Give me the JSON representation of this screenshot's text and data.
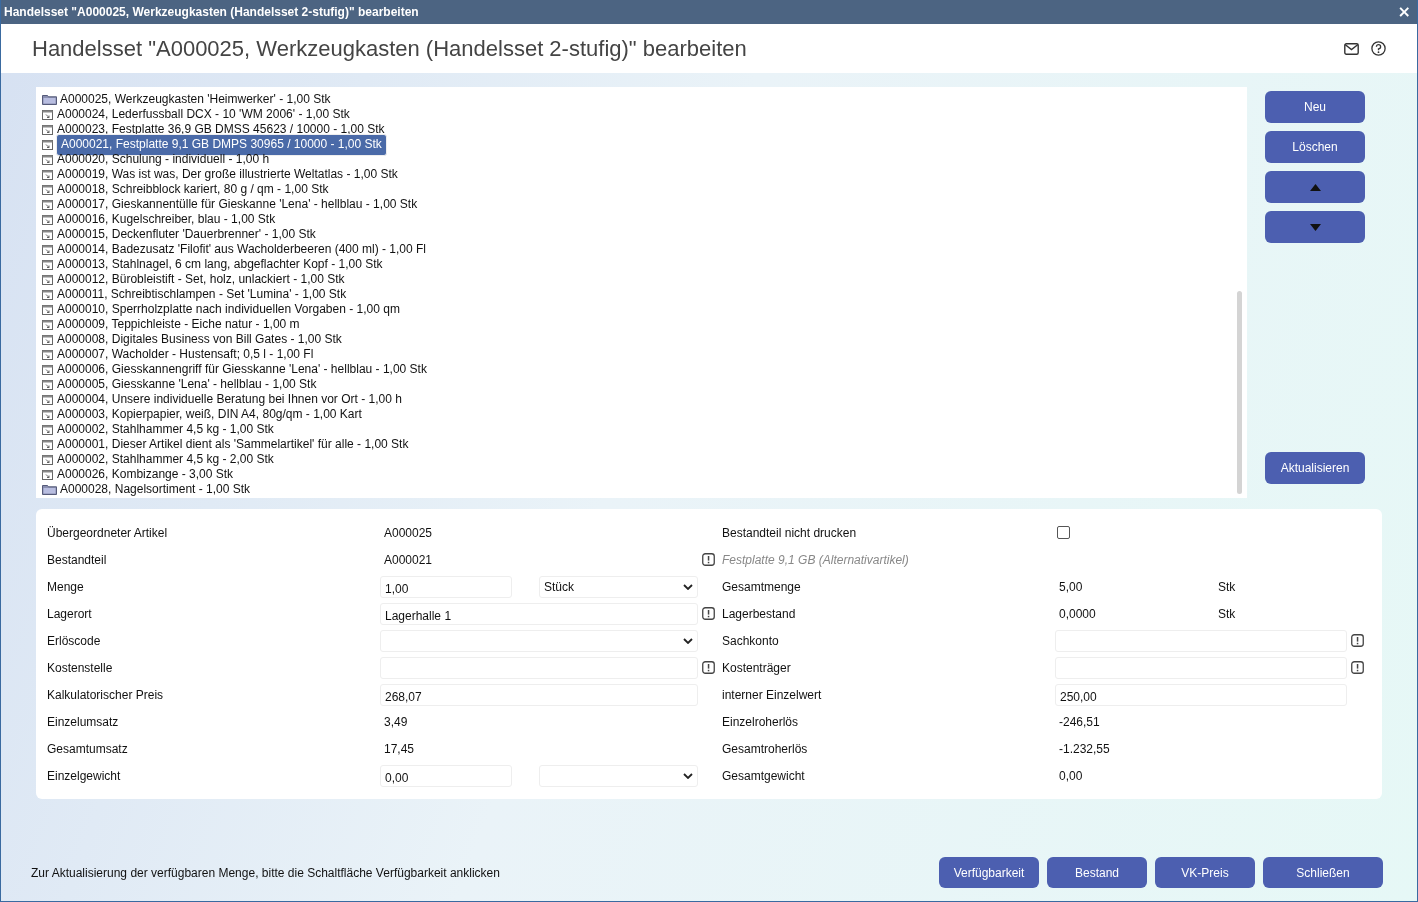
{
  "window": {
    "title": "Handelsset \"A000025, Werkzeugkasten (Handelsset 2-stufig)\" bearbeiten",
    "close": "×"
  },
  "header": {
    "title": "Handelsset \"A000025, Werkzeugkasten (Handelsset 2-stufig)\" bearbeiten"
  },
  "tree": {
    "items": [
      {
        "kind": "folder",
        "label": "A000025, Werkzeugkasten 'Heimwerker' - 1,00 Stk",
        "selected": false
      },
      {
        "kind": "article",
        "label": "A000024, Lederfussball DCX - 10 'WM 2006' - 1,00 Stk",
        "selected": false
      },
      {
        "kind": "article",
        "label": "A000023, Festplatte 36,9 GB DMSS 45623 / 10000 - 1,00 Stk",
        "selected": false
      },
      {
        "kind": "article",
        "label": "A000021, Festplatte 9,1 GB DMPS 30965 / 10000 - 1,00 Stk",
        "selected": true
      },
      {
        "kind": "article",
        "label": "A000020, Schulung - individuell - 1,00 h",
        "selected": false
      },
      {
        "kind": "article",
        "label": "A000019, Was ist was, Der große illustrierte Weltatlas - 1,00 Stk",
        "selected": false
      },
      {
        "kind": "article",
        "label": "A000018, Schreibblock kariert, 80 g / qm - 1,00 Stk",
        "selected": false
      },
      {
        "kind": "article",
        "label": "A000017, Gieskannentülle für Gieskanne 'Lena' - hellblau - 1,00 Stk",
        "selected": false
      },
      {
        "kind": "article",
        "label": "A000016, Kugelschreiber, blau - 1,00 Stk",
        "selected": false
      },
      {
        "kind": "article",
        "label": "A000015, Deckenfluter 'Dauerbrenner' - 1,00 Stk",
        "selected": false
      },
      {
        "kind": "article",
        "label": "A000014, Badezusatz 'Filofit' aus Wacholderbeeren (400 ml) - 1,00 Fl",
        "selected": false
      },
      {
        "kind": "article",
        "label": "A000013, Stahlnagel, 6 cm lang, abgeflachter Kopf - 1,00 Stk",
        "selected": false
      },
      {
        "kind": "article",
        "label": "A000012, Bürobleistift - Set, holz, unlackiert - 1,00 Stk",
        "selected": false
      },
      {
        "kind": "article",
        "label": "A000011, Schreibtischlampen - Set 'Lumina' - 1,00 Stk",
        "selected": false
      },
      {
        "kind": "article",
        "label": "A000010, Sperrholzplatte nach individuellen Vorgaben - 1,00 qm",
        "selected": false
      },
      {
        "kind": "article",
        "label": "A000009, Teppichleiste - Eiche natur - 1,00 m",
        "selected": false
      },
      {
        "kind": "article",
        "label": "A000008, Digitales Business von Bill Gates - 1,00 Stk",
        "selected": false
      },
      {
        "kind": "article",
        "label": "A000007, Wacholder - Hustensaft; 0,5 l - 1,00 Fl",
        "selected": false
      },
      {
        "kind": "article",
        "label": "A000006, Giesskannengriff für Giesskanne 'Lena' - hellblau - 1,00 Stk",
        "selected": false
      },
      {
        "kind": "article",
        "label": "A000005, Giesskanne 'Lena' - hellblau - 1,00 Stk",
        "selected": false
      },
      {
        "kind": "article",
        "label": "A000004, Unsere individuelle Beratung bei Ihnen vor Ort - 1,00 h",
        "selected": false
      },
      {
        "kind": "article",
        "label": "A000003, Kopierpapier, weiß, DIN A4, 80g/qm - 1,00 Kart",
        "selected": false
      },
      {
        "kind": "article",
        "label": "A000002, Stahlhammer 4,5 kg - 1,00 Stk",
        "selected": false
      },
      {
        "kind": "article",
        "label": "A000001, Dieser Artikel dient als 'Sammelartikel' für alle - 1,00 Stk",
        "selected": false
      },
      {
        "kind": "article",
        "label": "A000002, Stahlhammer 4,5 kg - 2,00 Stk",
        "selected": false
      },
      {
        "kind": "article",
        "label": "A000026, Kombizange - 3,00 Stk",
        "selected": false
      },
      {
        "kind": "folder",
        "label": "A000028, Nagelsortiment - 1,00 Stk",
        "selected": false
      }
    ]
  },
  "side_buttons": [
    {
      "kind": "text",
      "label": "Neu"
    },
    {
      "kind": "text",
      "label": "Löschen"
    },
    {
      "kind": "up"
    },
    {
      "kind": "down"
    }
  ],
  "refresh_button": "Aktualisieren",
  "form": {
    "rows": [
      {
        "left": {
          "label": "Übergeordneter Artikel",
          "kind": "text",
          "value": "A000025"
        },
        "right": {
          "label": "Bestandteil nicht drucken",
          "kind": "checkbox",
          "checked": false
        }
      },
      {
        "left": {
          "label": "Bestandteil",
          "kind": "text",
          "value": "A000021"
        },
        "right": {
          "label": "Festplatte 9,1 GB (Alternativartikel)",
          "kind": "note",
          "warn_before": true
        }
      },
      {
        "left": {
          "label": "Menge",
          "kind": "input_select",
          "value": "1,00",
          "option": "Stück"
        },
        "right": {
          "label": "Gesamtmenge",
          "kind": "text",
          "value": "5,00",
          "unit": "Stk"
        }
      },
      {
        "left": {
          "label": "Lagerort",
          "kind": "input",
          "value": "Lagerhalle 1"
        },
        "right": {
          "label": "Lagerbestand",
          "kind": "text",
          "value": "0,0000",
          "unit": "Stk",
          "warn_before": true
        }
      },
      {
        "left": {
          "label": "Erlöscode",
          "kind": "select"
        },
        "right": {
          "label": "Sachkonto",
          "kind": "input",
          "warn_after": true
        }
      },
      {
        "left": {
          "label": "Kostenstelle",
          "kind": "input"
        },
        "right": {
          "label": "Kostenträger",
          "kind": "input",
          "warn_before": true,
          "warn_after": true
        }
      },
      {
        "left": {
          "label": "Kalkulatorischer Preis",
          "kind": "input",
          "value": "268,07"
        },
        "right": {
          "label": "interner Einzelwert",
          "kind": "input",
          "value": "250,00"
        }
      },
      {
        "left": {
          "label": "Einzelumsatz",
          "kind": "text",
          "value": "3,49"
        },
        "right": {
          "label": "Einzelroherlös",
          "kind": "text",
          "value": "-246,51"
        }
      },
      {
        "left": {
          "label": "Gesamtumsatz",
          "kind": "text",
          "value": "17,45"
        },
        "right": {
          "label": "Gesamtroherlös",
          "kind": "text",
          "value": "-1.232,55"
        }
      },
      {
        "left": {
          "label": "Einzelgewicht",
          "kind": "input_select",
          "value": "0,00"
        },
        "right": {
          "label": "Gesamtgewicht",
          "kind": "text",
          "value": "0,00"
        }
      }
    ]
  },
  "footer": {
    "hint": "Zur Aktualisierung der verfügbaren Menge, bitte die Schaltfläche Verfügbarkeit anklicken",
    "buttons": [
      "Verfügbarkeit",
      "Bestand",
      "VK-Preis",
      "Schließen"
    ]
  }
}
